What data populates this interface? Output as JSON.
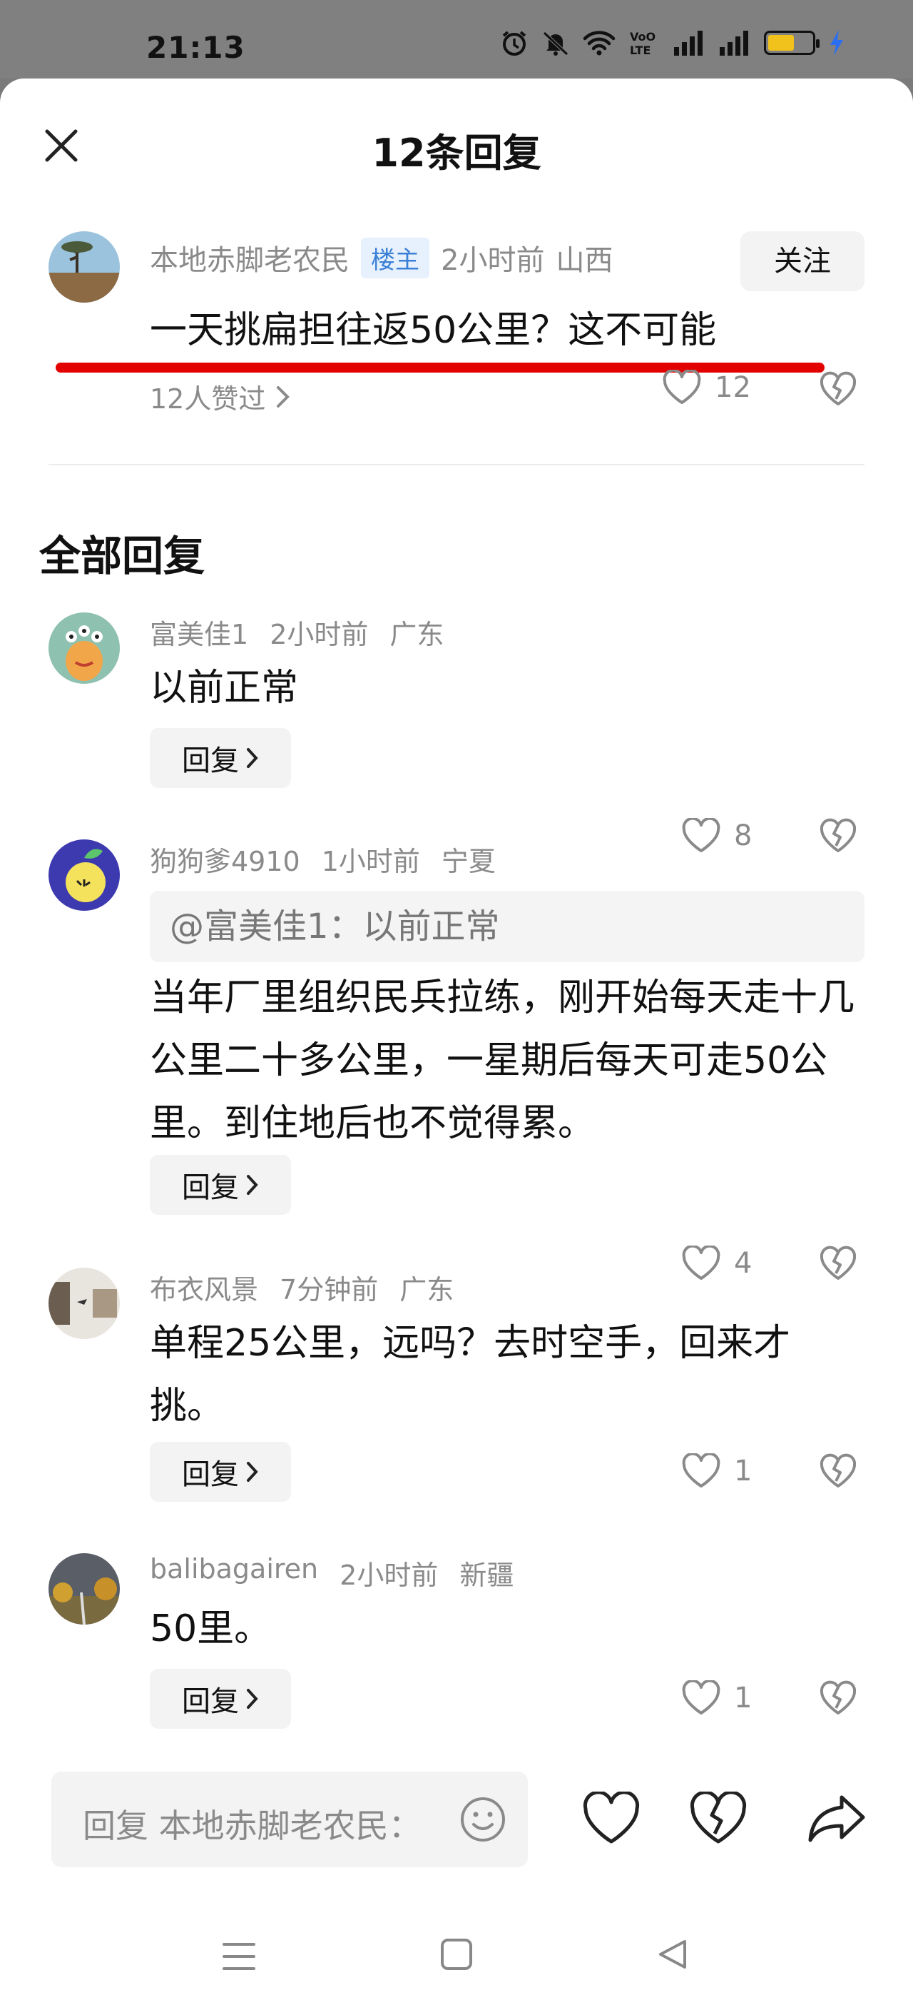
{
  "status_bar": {
    "time": "21:13",
    "icons": [
      "alarm-icon",
      "mute-icon",
      "wifi-icon",
      "volte-icon",
      "signal-icon",
      "signal-icon",
      "battery-icon",
      "charging-icon"
    ],
    "battery_level": 0.6,
    "battery_color": "#f0c21b"
  },
  "header": {
    "title": "12条回复",
    "close_icon": "close-icon"
  },
  "main_comment": {
    "username": "本地赤脚老农民",
    "badge": "楼主",
    "time": "2小时前",
    "location": "山西",
    "follow_label": "关注",
    "text": "一天挑扁担往返50公里？这不可能",
    "likes_summary": "12人赞过",
    "like_count": "12"
  },
  "section": {
    "title": "全部回复"
  },
  "replies": [
    {
      "username": "富美佳1",
      "time": "2小时前",
      "location": "广东",
      "text": "以前正常",
      "reply_label": "回复",
      "like_count": "8"
    },
    {
      "username": "狗狗爹4910",
      "time": "1小时前",
      "location": "宁夏",
      "quote": "@富美佳1：以前正常",
      "text": "当年厂里组织民兵拉练，刚开始每天走十几公里二十多公里，一星期后每天可走50公里。到住地后也不觉得累。",
      "reply_label": "回复",
      "like_count": "4"
    },
    {
      "username": "布衣风景",
      "time": "7分钟前",
      "location": "广东",
      "text": "单程25公里，远吗？去时空手，回来才挑。",
      "reply_label": "回复",
      "like_count": "1"
    },
    {
      "username": "balibagairen",
      "time": "2小时前",
      "location": "新疆",
      "text": "50里。",
      "reply_label": "回复",
      "like_count": "1"
    }
  ],
  "input_bar": {
    "placeholder": "回复 本地赤脚老农民："
  },
  "colors": {
    "accent_red": "#e30000",
    "badge_blue": "#3b7fd6",
    "muted_text": "#8a8a8a"
  }
}
